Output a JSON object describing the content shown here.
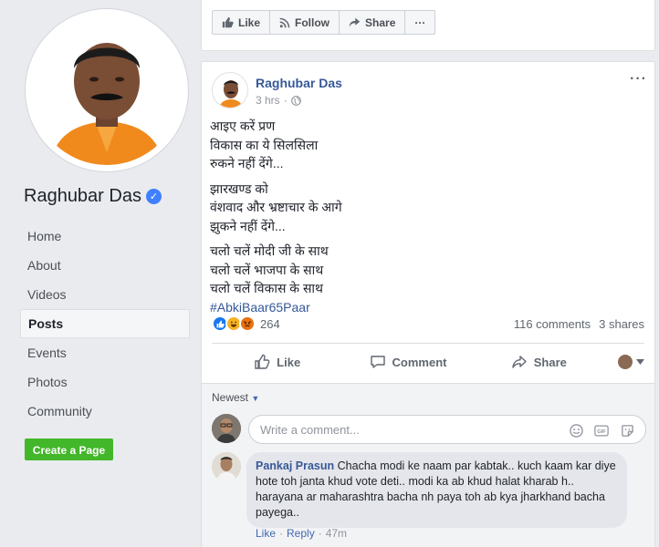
{
  "sidebar": {
    "page_name": "Raghubar Das",
    "nav": [
      "Home",
      "About",
      "Videos",
      "Posts",
      "Events",
      "Photos",
      "Community"
    ],
    "create_page": "Create a Page"
  },
  "topbar": {
    "like": "Like",
    "follow": "Follow",
    "share": "Share",
    "more": "···"
  },
  "post": {
    "author": "Raghubar Das",
    "time": "3 hrs",
    "time_sep": "·",
    "more": "···",
    "lines_1": [
      "आइए करें प्रण",
      "विकास का ये सिलसिला",
      "रुकने नहीं देंगे..."
    ],
    "lines_2": [
      "झारखण्ड को",
      "वंशवाद और भ्रष्टाचार के आगे",
      "झुकने नहीं देंगे..."
    ],
    "lines_3": [
      "चलो चलें मोदी जी के साथ",
      "चलो चलें भाजपा के साथ",
      "चलो चलें विकास के साथ"
    ],
    "hashtag": "#AbkiBaar65Paar",
    "reaction_count": "264",
    "comments": "116 comments",
    "shares": "3 shares",
    "actions": {
      "like": "Like",
      "comment": "Comment",
      "share": "Share"
    }
  },
  "comments": {
    "sort": "Newest",
    "placeholder": "Write a comment...",
    "items": [
      {
        "name": "Pankaj Prasun",
        "text": "Chacha modi ke naam par kabtak.. kuch kaam kar diye hote toh janta khud vote deti.. modi ka ab khud halat kharab h.. harayana ar maharashtra bacha nh paya toh ab kya jharkhand bacha payega..",
        "like": "Like",
        "reply": "Reply",
        "sep": "·",
        "time": "47m"
      }
    ]
  },
  "colors": {
    "link_blue": "#365899",
    "create_green": "#42b72a",
    "verified_blue": "#4080ff"
  }
}
